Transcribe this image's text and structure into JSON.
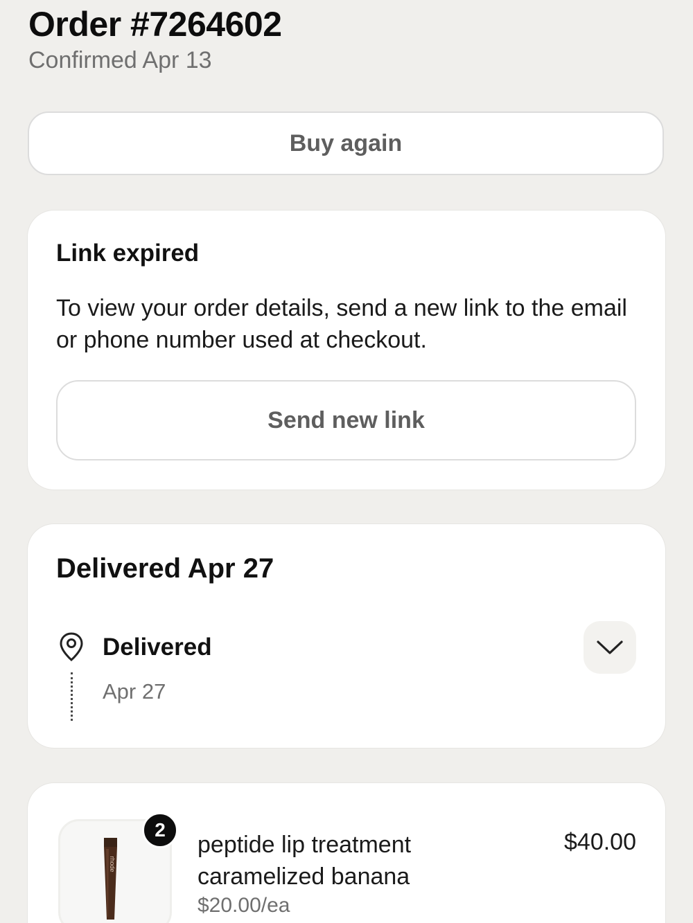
{
  "header": {
    "order_title": "Order #7264602",
    "confirmed": "Confirmed Apr 13"
  },
  "actions": {
    "buy_again": "Buy again"
  },
  "link_card": {
    "title": "Link expired",
    "body": "To view your order details, send a new link to the email or phone number used at checkout.",
    "send_button": "Send new link"
  },
  "delivery_card": {
    "title": "Delivered Apr 27",
    "status_label": "Delivered",
    "status_date": "Apr 27",
    "icons": {
      "location": "map-pin-icon",
      "expand": "chevron-down-icon"
    }
  },
  "item": {
    "quantity": "2",
    "name": "peptide lip treatment caramelized banana",
    "unit_price": "$20.00/ea",
    "total": "$40.00",
    "image_brand": "rhode"
  }
}
